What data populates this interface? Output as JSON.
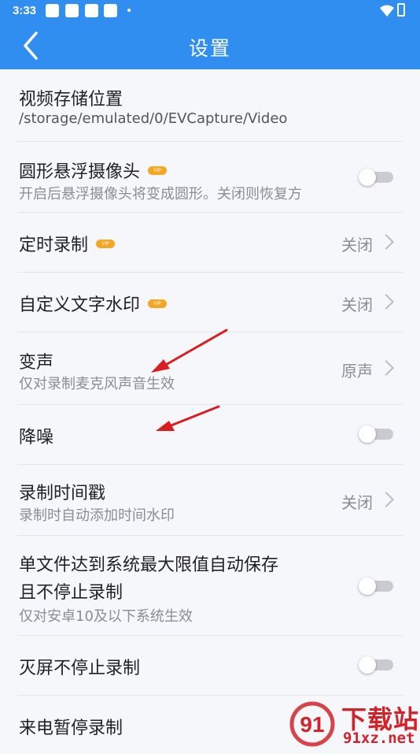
{
  "status_bar": {
    "time": "3:33"
  },
  "header": {
    "title": "设置"
  },
  "settings": [
    {
      "title": "视频存储位置",
      "subtitle": "/storage/emulated/0/EVCapture/Video"
    },
    {
      "title": "圆形悬浮摄像头",
      "vip": "VIP",
      "subtitle": "开启后悬浮摄像头将变成圆形。关闭则恢复方",
      "toggle": false
    },
    {
      "title": "定时录制",
      "vip": "VIP",
      "value": "关闭"
    },
    {
      "title": "自定义文字水印",
      "vip": "VIP",
      "value": "关闭"
    },
    {
      "title": "变声",
      "subtitle": "仅对录制麦克风声音生效",
      "value": "原声"
    },
    {
      "title": "降噪",
      "toggle": false
    },
    {
      "title": "录制时间戳",
      "subtitle": "录制时自动添加时间水印",
      "value": "关闭"
    },
    {
      "title": "单文件达到系统最大限值自动保存",
      "title2": "且不停止录制",
      "subtitle": "仅对安卓10及以下系统生效",
      "toggle": false
    },
    {
      "title": "灭屏不停止录制",
      "toggle": false
    },
    {
      "title": "来电暂停录制"
    }
  ],
  "watermark": {
    "brand": "下载站",
    "url": "91xz.net"
  },
  "colors": {
    "header": "#2f8ef0",
    "vip": "#f5a623",
    "arrow": "#d81e1e"
  }
}
